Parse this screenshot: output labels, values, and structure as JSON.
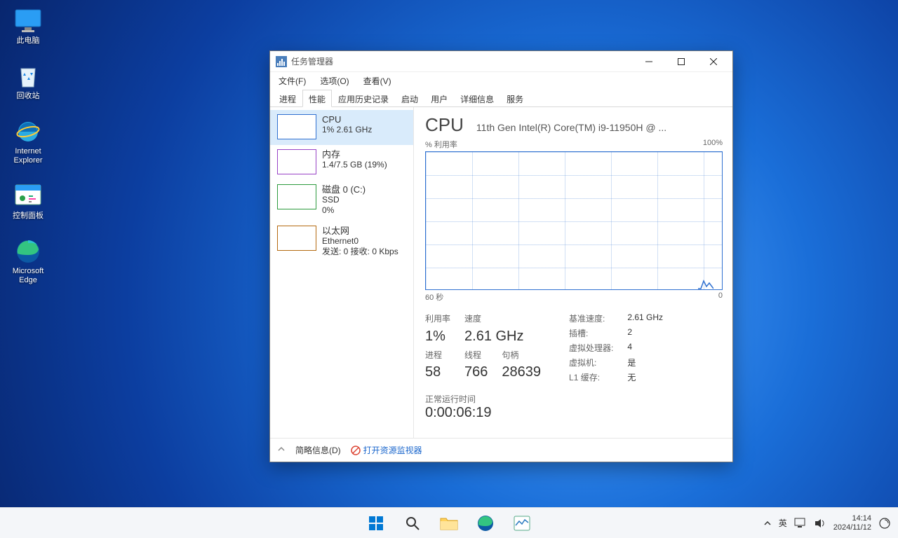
{
  "desktop": {
    "icons": [
      {
        "label": "此电脑"
      },
      {
        "label": "回收站"
      },
      {
        "label": "Internet Explorer"
      },
      {
        "label": "控制面板"
      },
      {
        "label": "Microsoft Edge"
      }
    ]
  },
  "window": {
    "title": "任务管理器",
    "menu": {
      "file": "文件(F)",
      "options": "选项(O)",
      "view": "查看(V)"
    },
    "tabs": [
      "进程",
      "性能",
      "应用历史记录",
      "启动",
      "用户",
      "详细信息",
      "服务"
    ],
    "sidebar": {
      "cpu": {
        "title": "CPU",
        "sub": "1%  2.61 GHz"
      },
      "mem": {
        "title": "内存",
        "sub": "1.4/7.5 GB (19%)"
      },
      "disk": {
        "title": "磁盘 0 (C:)",
        "l1": "SSD",
        "l2": "0%"
      },
      "eth": {
        "title": "以太网",
        "l1": "Ethernet0",
        "l2": "发送: 0 接收: 0 Kbps"
      }
    },
    "cpu": {
      "heading": "CPU",
      "model": "11th Gen Intel(R) Core(TM) i9-11950H @ ...",
      "ylabel": "% 利用率",
      "ymax": "100%",
      "xlabel_left": "60 秒",
      "xlabel_right": "0",
      "util_label": "利用率",
      "util_value": "1%",
      "speed_label": "速度",
      "speed_value": "2.61 GHz",
      "proc_label": "进程",
      "proc_value": "58",
      "thread_label": "线程",
      "thread_value": "766",
      "handle_label": "句柄",
      "handle_value": "28639",
      "base_label": "基准速度:",
      "base_value": "2.61 GHz",
      "sockets_label": "插槽:",
      "sockets_value": "2",
      "vproc_label": "虚拟处理器:",
      "vproc_value": "4",
      "vm_label": "虚拟机:",
      "vm_value": "是",
      "l1_label": "L1 缓存:",
      "l1_value": "无",
      "uptime_label": "正常运行时间",
      "uptime_value": "0:00:06:19"
    },
    "footer": {
      "less": "简略信息(D)",
      "link": "打开资源监视器"
    }
  },
  "chart_data": {
    "type": "line",
    "title": "CPU % 利用率",
    "xlabel": "秒",
    "ylabel": "% 利用率",
    "x_range": [
      60,
      0
    ],
    "ylim": [
      0,
      100
    ],
    "series": [
      {
        "name": "CPU",
        "values_approx": "~1% flat with a small ~8% spike near t=2s"
      }
    ]
  },
  "tray": {
    "ime": "英",
    "time": "14:14",
    "date": "2024/11/12"
  }
}
